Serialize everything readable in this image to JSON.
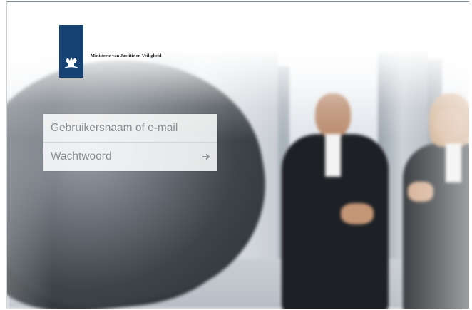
{
  "logo": {
    "ministry_name": "Ministerie van Justitie en Veiligheid",
    "icon": "dutch-coat-of-arms-icon",
    "bar_color": "#154273"
  },
  "login": {
    "username_placeholder": "Gebruikersnaam of e-mail",
    "password_placeholder": "Wachtwoord",
    "submit_icon": "arrow-right-icon"
  },
  "background": {
    "description_icon": "background-photo"
  }
}
